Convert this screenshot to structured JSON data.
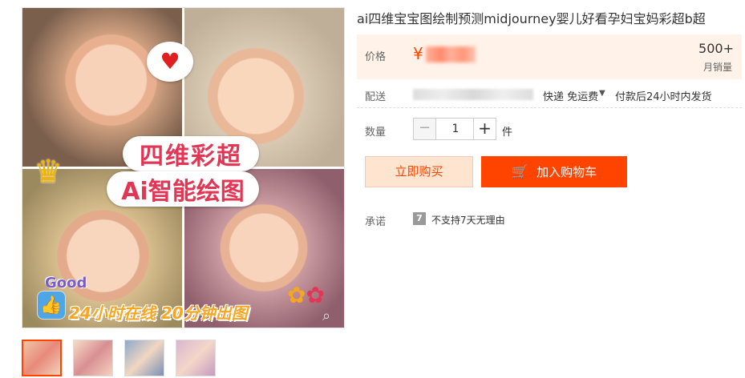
{
  "product": {
    "title": "ai四维宝宝图绘制预测midjourney婴儿好看孕妇宝妈彩超b超",
    "image_banner_line1": "四维彩超",
    "image_banner_line2": "Ai智能绘图",
    "image_bottom_text": "24小时在线  20分钟出图",
    "image_sticker_text": "Good"
  },
  "price": {
    "label": "价格",
    "currency": "¥",
    "sales_count": "500+",
    "sales_label": "月销量"
  },
  "shipping": {
    "label": "配送",
    "method": "快递 免运费",
    "dispatch_time": "付款后24小时内发货"
  },
  "quantity": {
    "label": "数量",
    "minus": "−",
    "value": "1",
    "plus": "+",
    "unit": "件"
  },
  "actions": {
    "buy_now": "立即购买",
    "add_to_cart": "加入购物车"
  },
  "promise": {
    "label": "承诺",
    "icon_text": "7",
    "text": "不支持7天无理由"
  },
  "icons": {
    "heart": "heart-icon",
    "crown": "crown-icon",
    "cart": "cart-icon",
    "zoom": "zoom-icon",
    "caret": "caret-down-icon"
  },
  "colors": {
    "accent": "#ff4400",
    "price_bg": "#fff2e8",
    "buy_bg": "#ffe4d0",
    "banner_text": "#e33554"
  }
}
